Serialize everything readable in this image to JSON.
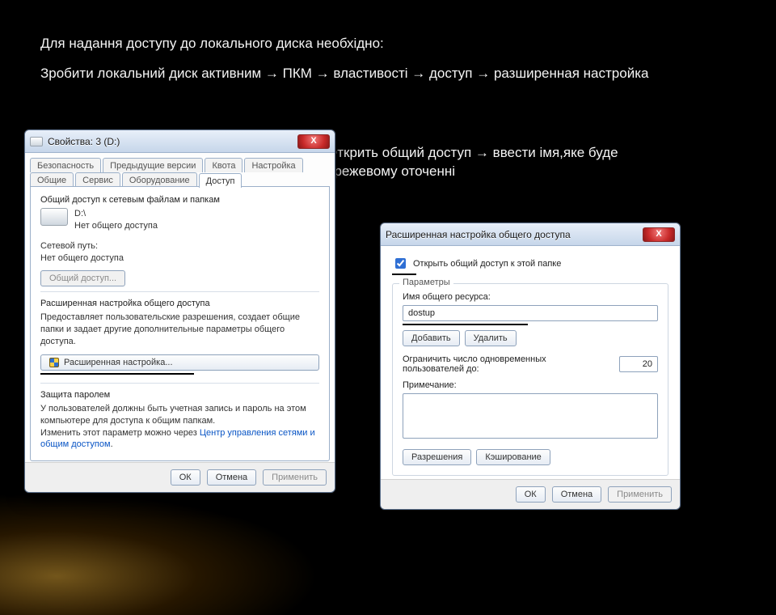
{
  "instructions": {
    "line1": "Для надання доступу до локального диска необхідно:",
    "line2": "Зробити локальний диск активним → ПКМ → властивості → доступ → разширенная настройка",
    "line3": "Открить общий доступ → ввести імя,яке буде ережевому оточенні"
  },
  "props_window": {
    "title": "Свойства: 3 (D:)",
    "close": "X",
    "tabs_row1": [
      "Безопасность",
      "Предыдущие версии",
      "Квота",
      "Настройка"
    ],
    "tabs_row2": [
      "Общие",
      "Сервис",
      "Оборудование",
      "Доступ"
    ],
    "active_tab": "Доступ",
    "share_section": {
      "heading": "Общий доступ к сетевым файлам и папкам",
      "drive_path": "D:\\",
      "drive_status": "Нет общего доступа",
      "netpath_label": "Сетевой путь:",
      "netpath_value": "Нет общего доступа",
      "share_btn": "Общий доступ..."
    },
    "advanced_section": {
      "heading": "Расширенная настройка общего доступа",
      "desc": "Предоставляет пользовательские разрешения, создает общие папки и задает другие дополнительные параметры общего доступа.",
      "btn": "Расширенная настройка..."
    },
    "password_section": {
      "heading": "Защита паролем",
      "desc_a": "У пользователей должны быть учетная запись и пароль на этом компьютере для доступа к общим папкам.",
      "desc_b": "Изменить этот параметр можно через ",
      "link": "Центр управления сетями и общим доступом",
      "desc_c": "."
    },
    "buttons": {
      "ok": "ОК",
      "cancel": "Отмена",
      "apply": "Применить"
    }
  },
  "adv_window": {
    "title": "Расширенная настройка общего доступа",
    "close": "X",
    "open_share_chk": "Открыть общий доступ к этой папке",
    "group_legend": "Параметры",
    "share_name_label": "Имя общего ресурса:",
    "share_name_value": "dostup",
    "add_btn": "Добавить",
    "del_btn": "Удалить",
    "limit_label": "Ограничить число одновременных пользователей до:",
    "limit_value": "20",
    "note_label": "Примечание:",
    "note_value": "",
    "perm_btn": "Разрешения",
    "cache_btn": "Кэширование",
    "buttons": {
      "ok": "ОК",
      "cancel": "Отмена",
      "apply": "Применить"
    }
  }
}
